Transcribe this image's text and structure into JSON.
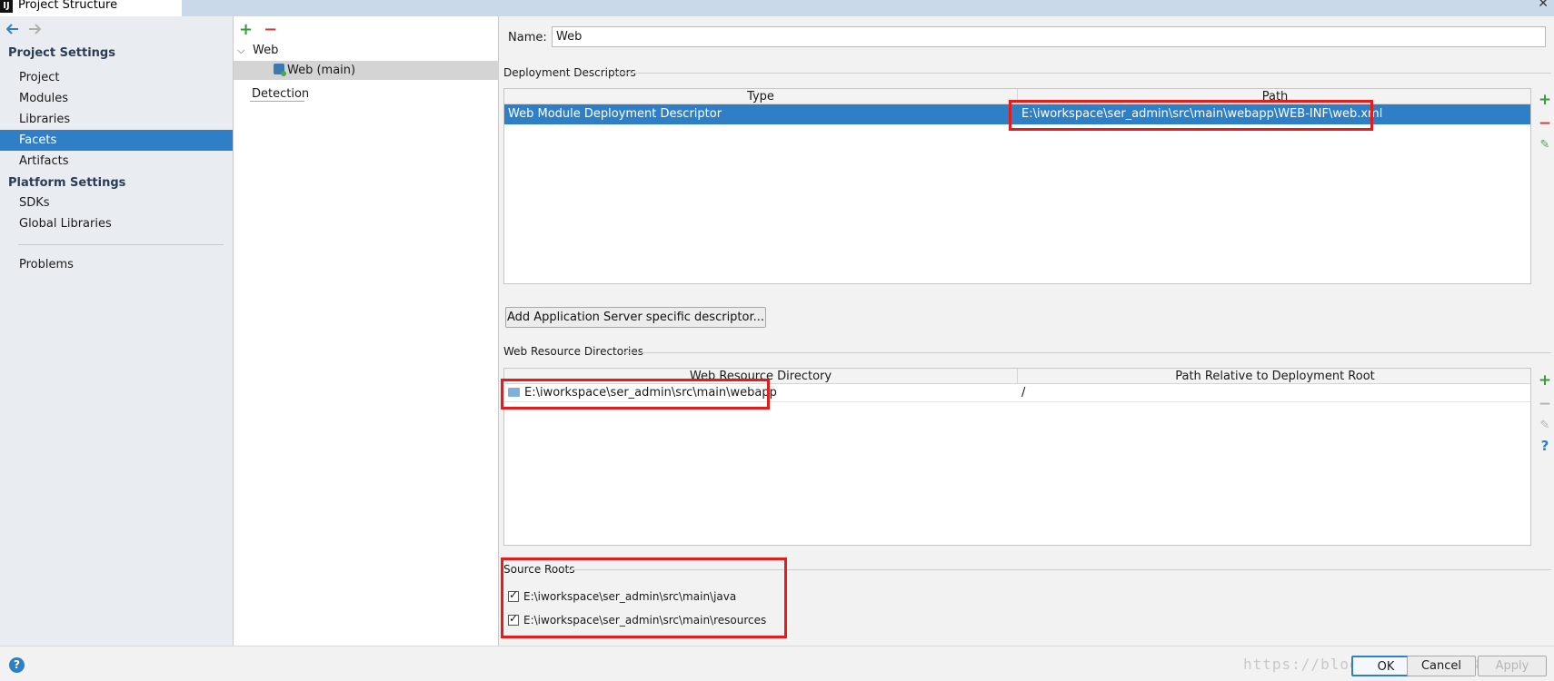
{
  "window": {
    "title": "Project Structure",
    "app_icon": "IJ",
    "close_icon": "✕"
  },
  "sidebar": {
    "nav_back_icon": "arrow-left-icon",
    "nav_forward_icon": "arrow-right-icon",
    "project_settings_header": "Project Settings",
    "project_settings_items": [
      "Project",
      "Modules",
      "Libraries",
      "Facets",
      "Artifacts"
    ],
    "selected_item": "Facets",
    "platform_settings_header": "Platform Settings",
    "platform_settings_items": [
      "SDKs",
      "Global Libraries"
    ],
    "problems": "Problems"
  },
  "tree": {
    "add_icon": "+",
    "remove_icon": "−",
    "root_label": "Web",
    "child_label": "Web (main)",
    "detection_label": "Detection"
  },
  "facet": {
    "name_label": "Name:",
    "name_value": "Web",
    "deployment_descriptors_title": "Deployment Descriptors",
    "dd_columns": [
      "Type",
      "Path"
    ],
    "dd_rows": [
      {
        "type": "Web Module Deployment Descriptor",
        "path": "E:\\iworkspace\\ser_admin\\src\\main\\webapp\\WEB-INF\\web.xml"
      }
    ],
    "add_server_descriptor_button": "Add Application Server specific descriptor...",
    "web_resource_dirs_title": "Web Resource Directories",
    "wr_columns": [
      "Web Resource Directory",
      "Path Relative to Deployment Root"
    ],
    "wr_rows": [
      {
        "directory": "E:\\iworkspace\\ser_admin\\src\\main\\webapp",
        "relative": "/"
      }
    ],
    "source_roots_title": "Source Roots",
    "source_roots": [
      {
        "path": "E:\\iworkspace\\ser_admin\\src\\main\\java",
        "checked": true
      },
      {
        "path": "E:\\iworkspace\\ser_admin\\src\\main\\resources",
        "checked": true
      }
    ]
  },
  "side_tools": {
    "add": "+",
    "remove": "−",
    "edit": "✎",
    "help": "?"
  },
  "footer": {
    "help_icon": "?",
    "watermark": "https://blog.csdn.net/…38775862",
    "ok_button": "OK",
    "cancel_button": "Cancel",
    "apply_button": "Apply"
  },
  "colors": {
    "selection": "#2f7fc6",
    "highlight_box": "#e51c1c",
    "add_green": "#3a9b3a",
    "remove_red": "#d23c3c"
  }
}
